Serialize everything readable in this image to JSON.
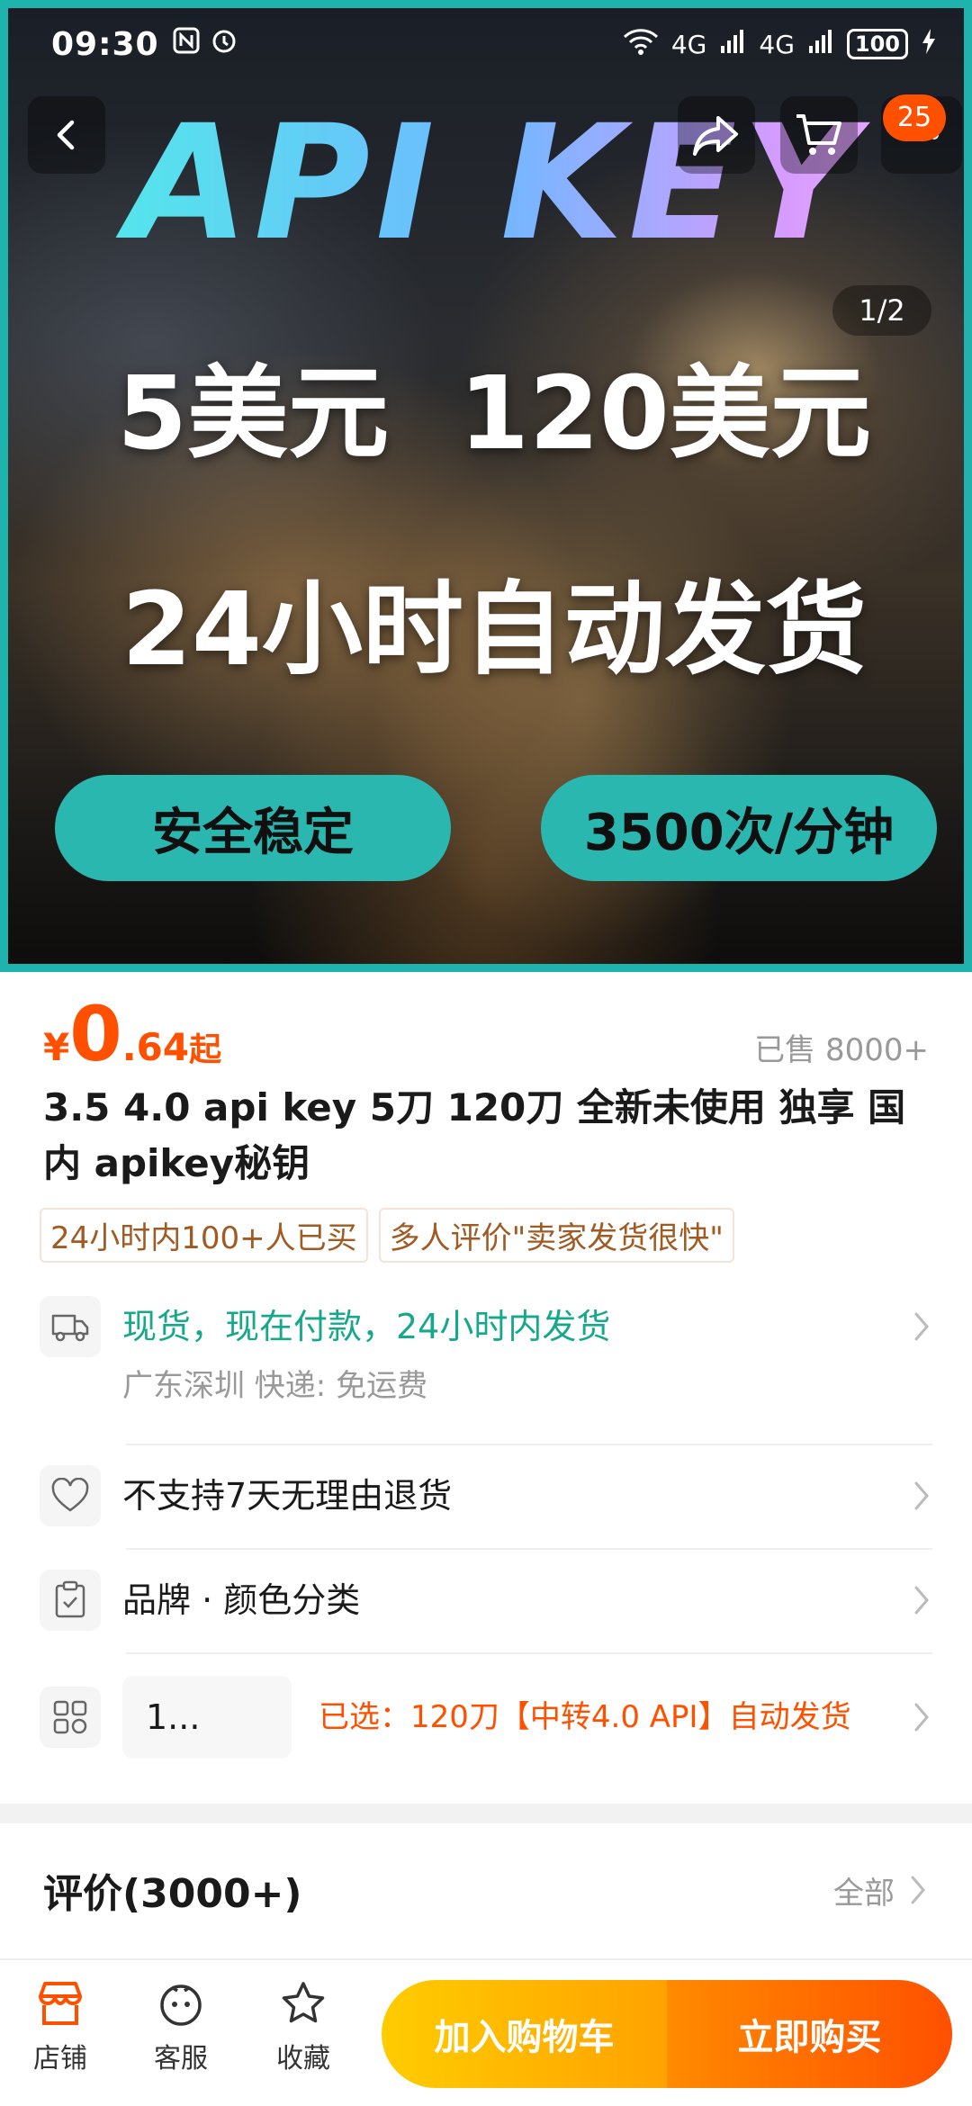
{
  "status_bar": {
    "time": "09:30",
    "battery": "100",
    "network1": "4G",
    "network2": "4G"
  },
  "hero": {
    "title": "API KEY",
    "line1": "5美元  120美元",
    "line2": "24小时自动发货",
    "pill_left": "安全稳定",
    "pill_right": "3500次/分钟",
    "pager": "1/2",
    "cart_badge": "25"
  },
  "price": {
    "currency": "¥",
    "int": "0",
    "dec": ".64",
    "suffix": "起",
    "sold": "已售 8000+"
  },
  "product_title": "3.5 4.0 api key 5刀 120刀 全新未使用 独享 国内 apikey秘钥",
  "tags": [
    "24小时内100+人已买",
    "多人评价\"卖家发货很快\""
  ],
  "shipping": {
    "main": "现货，现在付款，24小时内发货",
    "sub": "广东深圳  快递: 免运费"
  },
  "returns": {
    "main": "不支持7天无理由退货"
  },
  "specs": {
    "main": "品牌 · 颜色分类"
  },
  "selection": {
    "qty": "1...",
    "selected": "已选：120刀【中转4.0 API】自动发货"
  },
  "reviews": {
    "title": "评价(3000+)",
    "all": "全部"
  },
  "bottom_bar": {
    "shop": "店铺",
    "service": "客服",
    "favorite": "收藏",
    "add_to_cart": "加入购物车",
    "buy_now": "立即购买"
  },
  "colors": {
    "accent": "#ff5000",
    "teal": "#1fb3ad",
    "green_text": "#17a88c",
    "tag_text": "#a05a22"
  }
}
